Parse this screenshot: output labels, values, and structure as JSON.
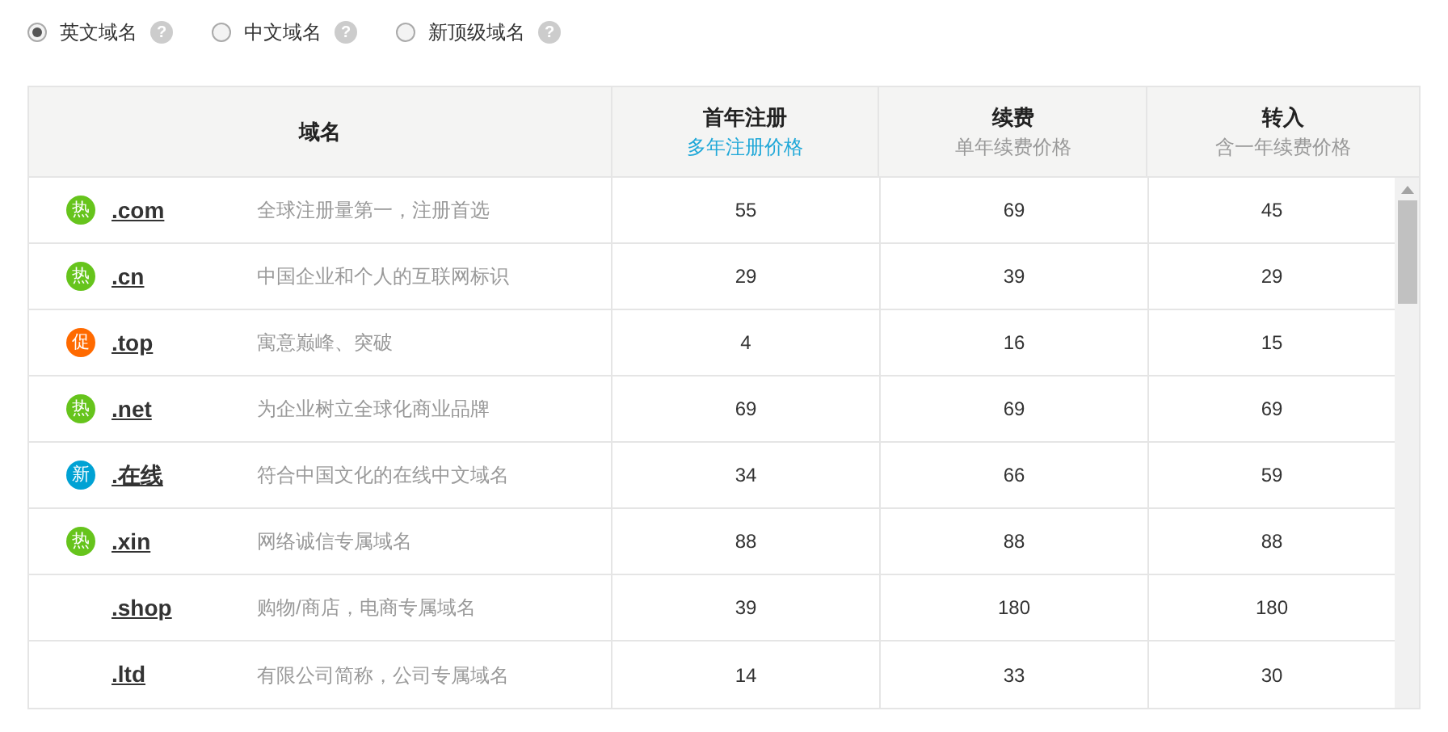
{
  "domain_types": [
    {
      "label": "英文域名",
      "selected": true,
      "help": "?"
    },
    {
      "label": "中文域名",
      "selected": false,
      "help": "?"
    },
    {
      "label": "新顶级域名",
      "selected": false,
      "help": "?"
    }
  ],
  "table": {
    "columns": [
      {
        "title": "域名"
      },
      {
        "title": "首年注册",
        "subtitle": "多年注册价格",
        "link": true
      },
      {
        "title": "续费",
        "subtitle": "单年续费价格",
        "link": false
      },
      {
        "title": "转入",
        "subtitle": "含一年续费价格",
        "link": false
      }
    ],
    "rows": [
      {
        "badge": "热",
        "color": "#66c41c",
        "domain": ".com",
        "description": "全球注册量第一，注册首选",
        "first_year": "55",
        "renewal": "69",
        "transfer": "45"
      },
      {
        "badge": "热",
        "color": "#66c41c",
        "domain": ".cn",
        "description": "中国企业和个人的互联网标识",
        "first_year": "29",
        "renewal": "39",
        "transfer": "29"
      },
      {
        "badge": "促",
        "color": "#ff6a00",
        "domain": ".top",
        "description": "寓意巅峰、突破",
        "first_year": "4",
        "renewal": "16",
        "transfer": "15"
      },
      {
        "badge": "热",
        "color": "#66c41c",
        "domain": ".net",
        "description": "为企业树立全球化商业品牌",
        "first_year": "69",
        "renewal": "69",
        "transfer": "69"
      },
      {
        "badge": "新",
        "color": "#00a2d4",
        "domain": ".在线",
        "description": "符合中国文化的在线中文域名",
        "first_year": "34",
        "renewal": "66",
        "transfer": "59"
      },
      {
        "badge": "热",
        "color": "#66c41c",
        "domain": ".xin",
        "description": "网络诚信专属域名",
        "first_year": "88",
        "renewal": "88",
        "transfer": "88"
      },
      {
        "domain": ".shop",
        "description": "购物/商店，电商专属域名",
        "first_year": "39",
        "renewal": "180",
        "transfer": "180"
      },
      {
        "domain": ".ltd",
        "description": "有限公司简称，公司专属域名",
        "first_year": "14",
        "renewal": "33",
        "transfer": "30"
      }
    ]
  }
}
